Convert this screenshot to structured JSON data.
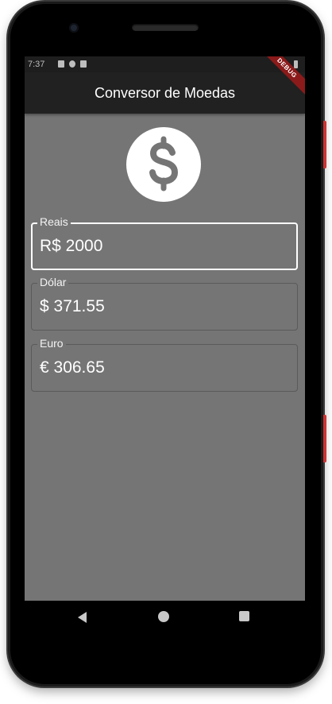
{
  "status_bar": {
    "time": "7:37"
  },
  "app_bar": {
    "title": "Conversor de Moedas",
    "debug_banner": "DEBUG"
  },
  "header_icon": "dollar-circle-icon",
  "fields": [
    {
      "label": "Reais",
      "value": "R$ 2000",
      "focused": true
    },
    {
      "label": "Dólar",
      "value": "$ 371.55",
      "focused": false
    },
    {
      "label": "Euro",
      "value": "€ 306.65",
      "focused": false
    }
  ],
  "nav_bar": {
    "icons": [
      "back-icon",
      "home-icon",
      "recent-apps-icon"
    ]
  },
  "colors": {
    "app_bar": "#212121",
    "background": "#757575",
    "field_focused_border": "#ffffff",
    "field_border": "#5a5a5a",
    "text": "#ffffff"
  }
}
